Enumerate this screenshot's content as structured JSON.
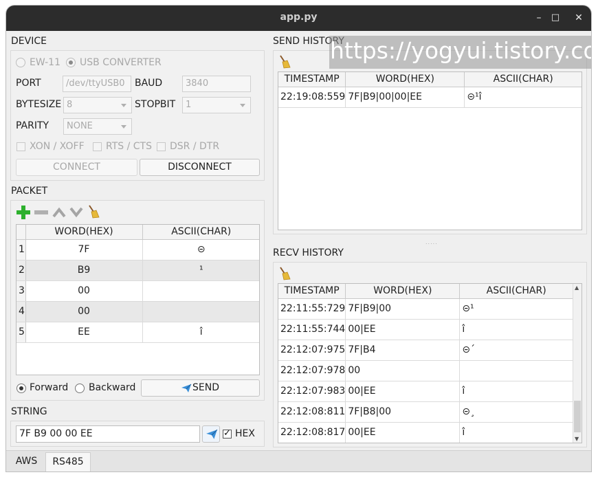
{
  "window": {
    "title": "app.py",
    "minimize": "–",
    "maximize": "□",
    "close": "✕"
  },
  "device": {
    "section_label": "DEVICE",
    "mode_ew11": "EW-11",
    "mode_usb": "USB CONVERTER",
    "port_label": "PORT",
    "port_value": "/dev/ttyUSB0",
    "baud_label": "BAUD",
    "baud_value": "3840",
    "bytesize_label": "BYTESIZE",
    "bytesize_value": "8",
    "stopbit_label": "STOPBIT",
    "stopbit_value": "1",
    "parity_label": "PARITY",
    "parity_value": "NONE",
    "xon_xoff": "XON / XOFF",
    "rts_cts": "RTS / CTS",
    "dsr_dtr": "DSR / DTR",
    "connect": "CONNECT",
    "disconnect": "DISCONNECT"
  },
  "packet": {
    "section_label": "PACKET",
    "headers": [
      "WORD(HEX)",
      "ASCII(CHAR)"
    ],
    "rows": [
      {
        "n": "1",
        "hex": "7F",
        "ascii": "⊝"
      },
      {
        "n": "2",
        "hex": "B9",
        "ascii": "¹"
      },
      {
        "n": "3",
        "hex": "00",
        "ascii": ""
      },
      {
        "n": "4",
        "hex": "00",
        "ascii": ""
      },
      {
        "n": "5",
        "hex": "EE",
        "ascii": "î"
      }
    ],
    "forward": "Forward",
    "backward": "Backward",
    "send": "SEND"
  },
  "string": {
    "section_label": "STRING",
    "value": "7F B9 00 00 EE",
    "hex_label": "HEX"
  },
  "send_history": {
    "section_label": "SEND HISTORY",
    "headers": [
      "TIMESTAMP",
      "WORD(HEX)",
      "ASCII(CHAR)"
    ],
    "rows": [
      {
        "ts": "22:19:08:559",
        "hex": "7F|B9|00|00|EE",
        "ascii": "⊝¹î"
      }
    ]
  },
  "recv_history": {
    "section_label": "RECV HISTORY",
    "headers": [
      "TIMESTAMP",
      "WORD(HEX)",
      "ASCII(CHAR)"
    ],
    "rows": [
      {
        "ts": "22:11:55:729",
        "hex": "7F|B9|00",
        "ascii": "⊝¹"
      },
      {
        "ts": "22:11:55:744",
        "hex": "00|EE",
        "ascii": "î"
      },
      {
        "ts": "22:12:07:975",
        "hex": "7F|B4",
        "ascii": "⊝´"
      },
      {
        "ts": "22:12:07:978",
        "hex": "00",
        "ascii": ""
      },
      {
        "ts": "22:12:07:983",
        "hex": "00|EE",
        "ascii": "î"
      },
      {
        "ts": "22:12:08:811",
        "hex": "7F|B8|00",
        "ascii": "⊝¸"
      },
      {
        "ts": "22:12:08:817",
        "hex": "00|EE",
        "ascii": "î"
      }
    ]
  },
  "watermark": "https://yogyui.tistory.com",
  "tabs": [
    "AWS",
    "RS485"
  ],
  "colors": {
    "titlebar": "#2c2c2c",
    "add_icon": "#2db02d",
    "send_icon": "#3a8fd8"
  }
}
